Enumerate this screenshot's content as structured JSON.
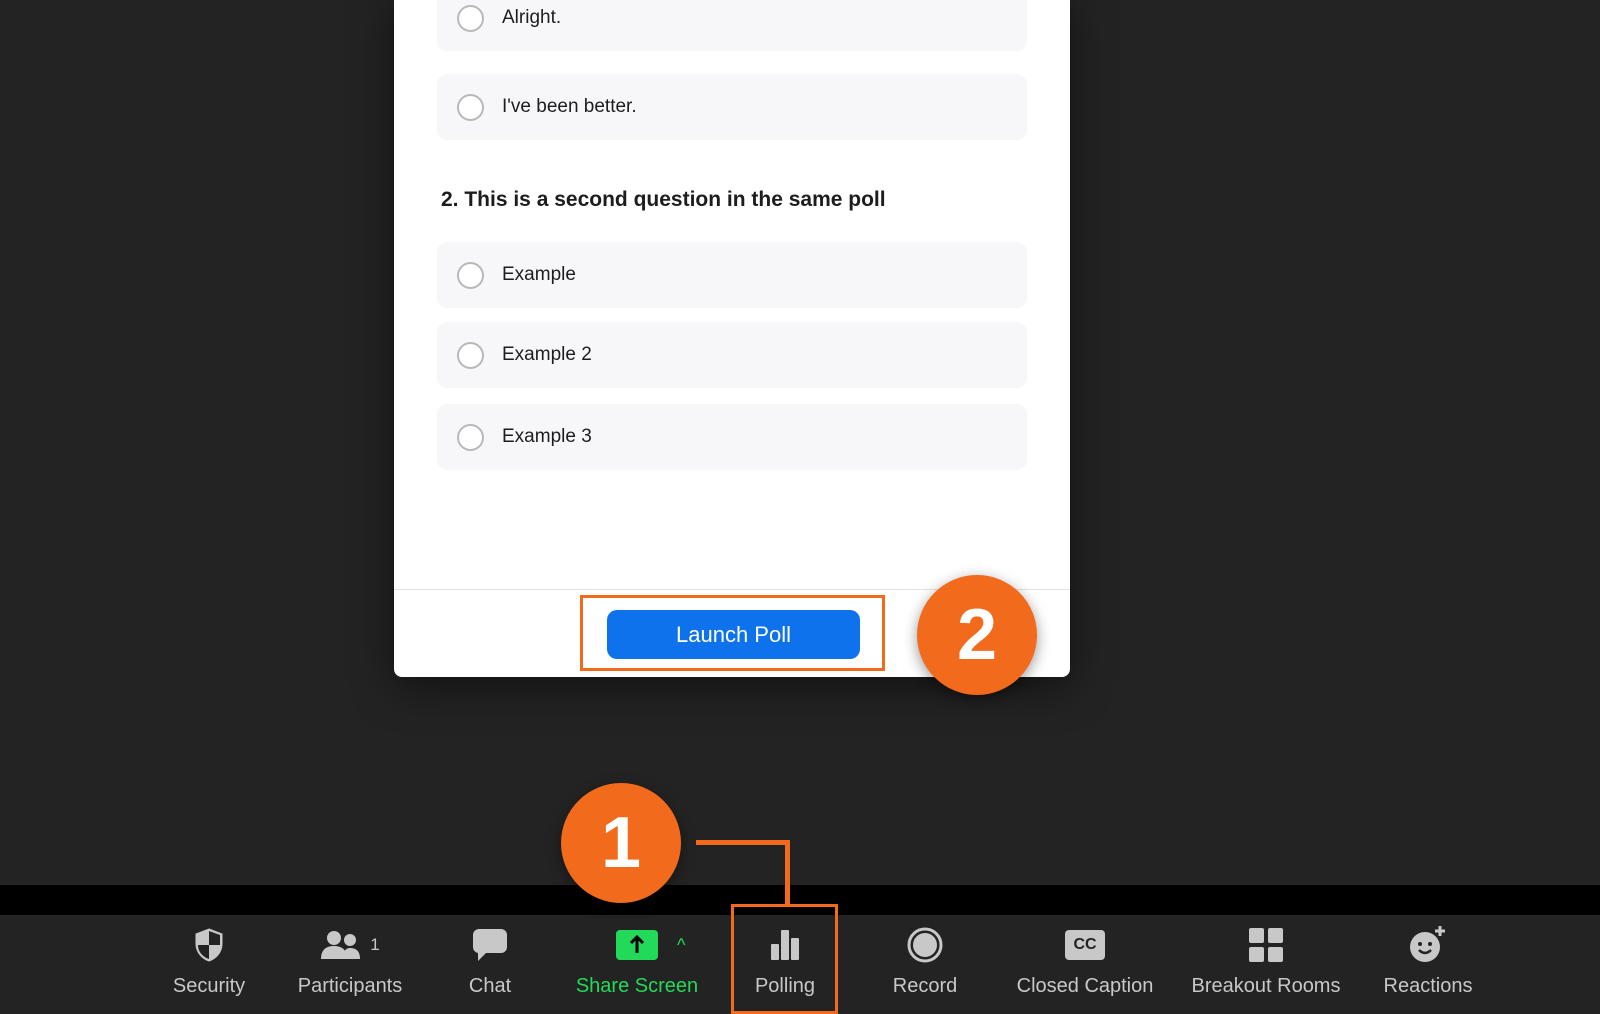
{
  "poll": {
    "q1_options": [
      "Alright.",
      "I've been better."
    ],
    "question2": "2. This is a second question in the same poll",
    "q2_options": [
      "Example",
      "Example 2",
      "Example 3"
    ],
    "launch_label": "Launch Poll"
  },
  "callouts": {
    "step1": "1",
    "step2": "2"
  },
  "toolbar": {
    "security": "Security",
    "participants": "Participants",
    "participants_count": "1",
    "chat": "Chat",
    "share_screen": "Share Screen",
    "polling": "Polling",
    "record": "Record",
    "closed_caption": "Closed Caption",
    "cc_badge": "CC",
    "breakout_rooms": "Breakout Rooms",
    "reactions": "Reactions"
  },
  "colors": {
    "accent": "#0e72ed",
    "callout": "#f26a1b",
    "share": "#23d959"
  }
}
